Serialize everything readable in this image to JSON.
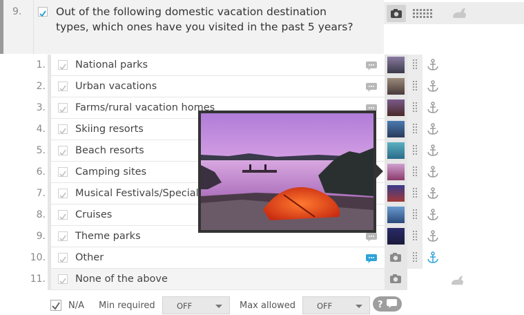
{
  "question": {
    "number": "9.",
    "text": "Out of the following domestic vacation destination types, which ones have you visited in the past 5 years?"
  },
  "options": [
    {
      "number": "1.",
      "label": "National parks",
      "thumb": "#5a4a6a"
    },
    {
      "number": "2.",
      "label": "Urban vacations",
      "thumb": "#6a5a4a"
    },
    {
      "number": "3.",
      "label": "Farms/rural vacation homes",
      "thumb": "#6a4a5a"
    },
    {
      "number": "4.",
      "label": "Skiing resorts",
      "thumb": "#3a5a8a"
    },
    {
      "number": "5.",
      "label": "Beach resorts",
      "thumb": "#3a8aa0"
    },
    {
      "number": "6.",
      "label": "Camping sites",
      "thumb": "#b06aa0"
    },
    {
      "number": "7.",
      "label": "Musical Festivals/Special",
      "thumb": "#3a3a7a"
    },
    {
      "number": "8.",
      "label": "Cruises",
      "thumb": "#3a6aa0"
    },
    {
      "number": "9.",
      "label": "Theme parks",
      "thumb": "#2a2a6a"
    },
    {
      "number": "10.",
      "label": "Other"
    },
    {
      "number": "11.",
      "label": "None of the above"
    }
  ],
  "bottom": {
    "na_label": "N/A",
    "min_label": "Min required",
    "min_value": "OFF",
    "max_label": "Max allowed",
    "max_value": "OFF"
  },
  "colors": {
    "accent": "#2ea3d9",
    "anchor": "#9a9a9a"
  }
}
